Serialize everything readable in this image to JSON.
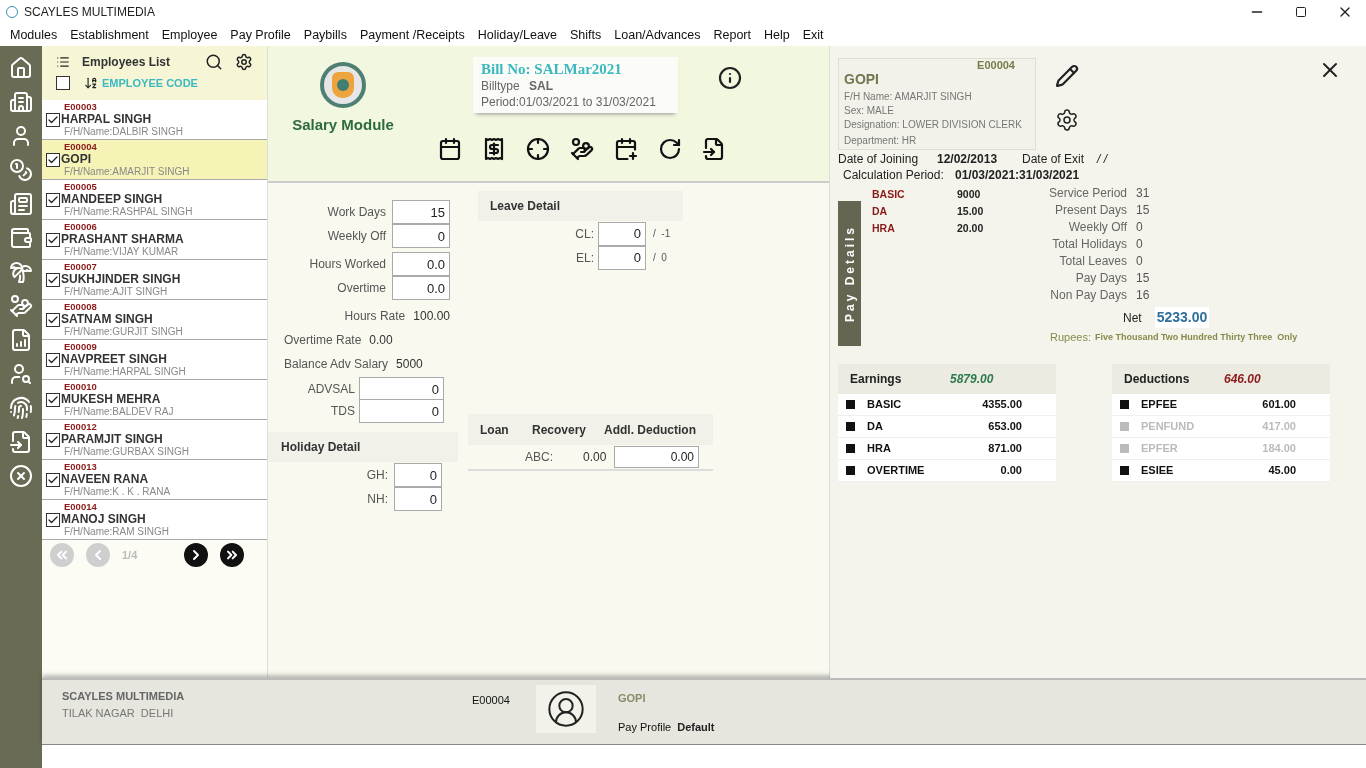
{
  "window": {
    "title": "SCAYLES MULTIMEDIA"
  },
  "menu": [
    "Modules",
    "Establishment",
    "Employee",
    "Pay Profile",
    "Paybills",
    "Payment /Receipts",
    "Holiday/Leave",
    "Shifts",
    "Loan/Advances",
    "Report",
    "Help",
    "Exit"
  ],
  "employee_list": {
    "title": "Employees List",
    "select_all_checked": false,
    "sort_label": "EMPLOYEE CODE",
    "employees": [
      {
        "code": "E00003",
        "name": "HARPAL SINGH",
        "fh": "F/H/Name:DALBIR SINGH",
        "checked": true,
        "selected": false
      },
      {
        "code": "E00004",
        "name": "GOPI",
        "fh": "F/H/Name:AMARJIT SINGH",
        "checked": true,
        "selected": true
      },
      {
        "code": "E00005",
        "name": "MANDEEP SINGH",
        "fh": "F/H/Name:RASHPAL SINGH",
        "checked": true,
        "selected": false
      },
      {
        "code": "E00006",
        "name": "PRASHANT SHARMA",
        "fh": "F/H/Name:VIJAY KUMAR",
        "checked": true,
        "selected": false
      },
      {
        "code": "E00007",
        "name": "SUKHJINDER SINGH",
        "fh": "F/H/Name:AJIT SINGH",
        "checked": true,
        "selected": false
      },
      {
        "code": "E00008",
        "name": "SATNAM SINGH",
        "fh": "F/H/Name:GURJIT SINGH",
        "checked": true,
        "selected": false
      },
      {
        "code": "E00009",
        "name": "NAVPREET SINGH",
        "fh": "F/H/Name:HARPAL SINGH",
        "checked": true,
        "selected": false
      },
      {
        "code": "E00010",
        "name": "MUKESH MEHRA",
        "fh": "F/H/Name:BALDEV RAJ",
        "checked": true,
        "selected": false
      },
      {
        "code": "E00012",
        "name": "PARAMJIT SINGH",
        "fh": "F/H/Name:GURBAX SINGH",
        "checked": true,
        "selected": false
      },
      {
        "code": "E00013",
        "name": "NAVEEN RANA",
        "fh": "F/H/Name:K . K . RANA",
        "checked": true,
        "selected": false
      },
      {
        "code": "E00014",
        "name": "MANOJ SINGH",
        "fh": "F/H/Name:RAM SINGH",
        "checked": true,
        "selected": false
      }
    ],
    "pager": {
      "page": "1/4",
      "first_disabled": true,
      "prev_disabled": true,
      "next_disabled": false,
      "last_disabled": false
    }
  },
  "module": {
    "title": "Salary Module",
    "bill_no": "Bill No: SALMar2021",
    "billtype_label": "Billtype",
    "billtype": "SAL",
    "period": "Period:01/03/2021 to 31/03/2021"
  },
  "attendance": [
    {
      "label": "Work Days",
      "value": "15",
      "kind": "input"
    },
    {
      "label": "Weekly Off",
      "value": "0",
      "kind": "input"
    },
    {
      "label": "Hours Worked",
      "value": "0.0",
      "kind": "input"
    },
    {
      "label": "Overtime",
      "value": "0.0",
      "kind": "input"
    },
    {
      "label": "Hours Rate",
      "value": "100.00",
      "kind": "text"
    },
    {
      "label": "Overtime Rate",
      "value": "0.00",
      "kind": "text"
    },
    {
      "label": "Balance Adv Salary",
      "value": "5000",
      "kind": "text"
    },
    {
      "label": "ADVSAL",
      "value": "0",
      "kind": "wide"
    },
    {
      "label": "TDS",
      "value": "0",
      "kind": "wide"
    }
  ],
  "holiday_detail": {
    "title": "Holiday Detail",
    "rows": [
      {
        "label": "GH:",
        "value": "0"
      },
      {
        "label": "NH:",
        "value": "0"
      }
    ]
  },
  "leave_detail": {
    "title": "Leave Detail",
    "rows": [
      {
        "label": "CL:",
        "value": "0",
        "balance": "/  -1"
      },
      {
        "label": "EL:",
        "value": "0",
        "balance": "/  0"
      }
    ]
  },
  "loan": {
    "columns": [
      "Loan",
      "Recovery",
      "Addl. Deduction"
    ],
    "rows": [
      {
        "name": "ABC:",
        "recovery": "0.00",
        "addl": "0.00"
      }
    ]
  },
  "profile": {
    "code": "E00004",
    "name": "GOPI",
    "fh": "F/H Name: AMARJIT SINGH",
    "sex": "Sex: MALE",
    "designation": "Designation: LOWER DIVISION CLERK",
    "department": "Department: HR",
    "doj_label": "Date of Joining",
    "doj": "12/02/2013",
    "doe_label": "Date of Exit",
    "doe": "/ /",
    "calc_label": "Calculation Period:",
    "calc": "01/03/2021:31/03/2021"
  },
  "pay_tab": "Pay Details",
  "rates": [
    {
      "name": "BASIC",
      "value": "9000"
    },
    {
      "name": "DA",
      "value": "15.00"
    },
    {
      "name": "HRA",
      "value": "20.00"
    }
  ],
  "days": [
    {
      "label": "Service Period",
      "value": "31"
    },
    {
      "label": "Present Days",
      "value": "15"
    },
    {
      "label": "Weekly Off",
      "value": "0"
    },
    {
      "label": "Total Holidays",
      "value": "0"
    },
    {
      "label": "Total Leaves",
      "value": "0"
    },
    {
      "label": "Pay Days",
      "value": "15"
    },
    {
      "label": "Non Pay Days",
      "value": "16"
    }
  ],
  "net": {
    "label": "Net",
    "value": "5233.00",
    "rupees_label": "Rupees:",
    "words": "Five Thousand Two Hundred Thirty Three  Only"
  },
  "earnings": {
    "title": "Earnings",
    "total": "5879.00",
    "items": [
      {
        "name": "BASIC",
        "amount": "4355.00",
        "active": true
      },
      {
        "name": "DA",
        "amount": "653.00",
        "active": true
      },
      {
        "name": "HRA",
        "amount": "871.00",
        "active": true
      },
      {
        "name": "OVERTIME",
        "amount": "0.00",
        "active": true
      }
    ]
  },
  "deductions": {
    "title": "Deductions",
    "total": "646.00",
    "items": [
      {
        "name": "EPFEE",
        "amount": "601.00",
        "active": true
      },
      {
        "name": "PENFUND",
        "amount": "417.00",
        "active": false
      },
      {
        "name": "EPFER",
        "amount": "184.00",
        "active": false
      },
      {
        "name": "ESIEE",
        "amount": "45.00",
        "active": true
      }
    ]
  },
  "footer": {
    "company": "SCAYLES MULTIMEDIA",
    "address": "TILAK NAGAR  DELHI",
    "code": "E00004",
    "name": "GOPI",
    "pay_profile_label": "Pay Profile",
    "pay_profile": "Default"
  }
}
